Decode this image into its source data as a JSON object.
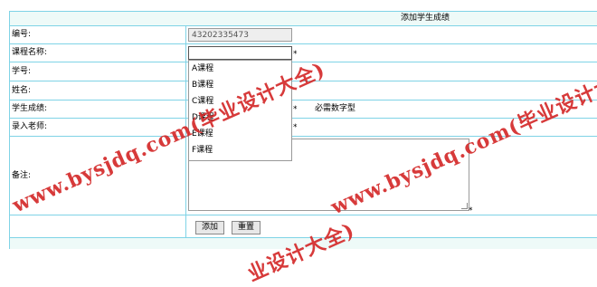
{
  "form": {
    "title": "添加学生成绩",
    "labels": {
      "student_id_code": "编号:",
      "course_name": "课程名称:",
      "student_no": "学号:",
      "name": "姓名:",
      "score": "学生成绩:",
      "teacher": "录入老师:",
      "remark": "备注:"
    },
    "values": {
      "student_id_code": "43202335473",
      "course_name": ""
    },
    "required_mark": "*",
    "score_hint": "必需数字型",
    "course_options": [
      "A课程",
      "B课程",
      "C课程",
      "D课程",
      "E课程",
      "F课程"
    ],
    "buttons": {
      "add": "添加",
      "reset": "重置"
    }
  },
  "watermark": {
    "text": "www.bysjdq.com(毕业设计大全)",
    "text_short": "www.bysjdq.com(毕业设计大全",
    "text_bottom": "业设计大全)",
    "color": "#d42a2a"
  },
  "colors": {
    "grid_line": "#7fd3e6",
    "header_bg": "#eefaf8"
  }
}
